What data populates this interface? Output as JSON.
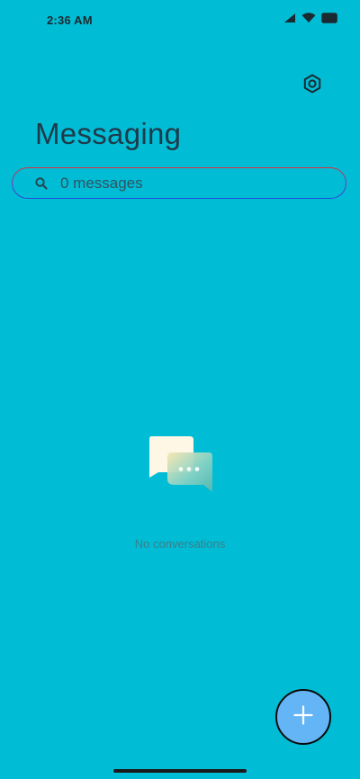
{
  "status_bar": {
    "time": "2:36 AM",
    "icons": [
      "signal-icon",
      "wifi-icon",
      "battery-icon"
    ]
  },
  "header": {
    "title": "Messaging",
    "settings_icon": "settings-icon"
  },
  "search": {
    "placeholder": "0 messages",
    "value": "",
    "icon": "search-icon"
  },
  "empty_state": {
    "icon": "conversation-bubbles-icon",
    "text": "No conversations"
  },
  "fab": {
    "icon": "plus-icon",
    "color": "#64B5F6"
  },
  "theme": {
    "background": "#00BCD4"
  }
}
